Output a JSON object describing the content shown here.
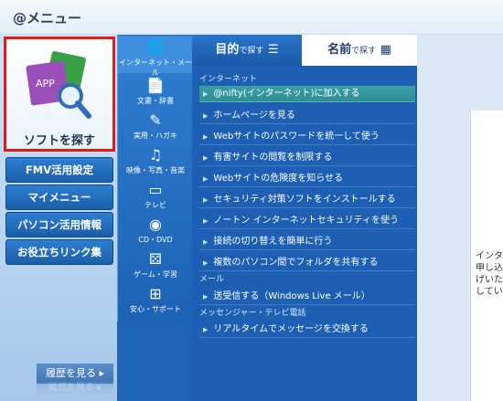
{
  "app": {
    "title": "@メニュー"
  },
  "left": {
    "find_software": "ソフトを探す",
    "app_icon_label": "APP",
    "menu": [
      {
        "label": "FMV活用設定"
      },
      {
        "label": "マイメニュー"
      },
      {
        "label": "パソコン活用情報"
      },
      {
        "label": "お役立ちリンク集"
      }
    ],
    "history": "履歴を見る ▸",
    "history_reflection": "履歴を見る ▸"
  },
  "categories": [
    {
      "label": "インターネット・メール",
      "icon": "globe-mail-icon",
      "glyph": "🌐"
    },
    {
      "label": "文書・辞書",
      "icon": "document-icon",
      "glyph": "📄"
    },
    {
      "label": "実用・ハガキ",
      "icon": "postcard-icon",
      "glyph": "✎"
    },
    {
      "label": "映像・写真・音楽",
      "icon": "media-icon",
      "glyph": "♫"
    },
    {
      "label": "テレビ",
      "icon": "tv-icon",
      "glyph": "▭"
    },
    {
      "label": "CD・DVD",
      "icon": "disc-icon",
      "glyph": "◉"
    },
    {
      "label": "ゲーム・学習",
      "icon": "dice-icon",
      "glyph": "⚄"
    },
    {
      "label": "安心・サポート",
      "icon": "windows-icon",
      "glyph": "⊞"
    }
  ],
  "tabs": {
    "purpose": "目的",
    "purpose_suffix": "で探す",
    "name": "名前",
    "name_suffix": "で探す"
  },
  "sections": [
    {
      "title": "インターネット",
      "items": [
        "@nifty(インターネット)に加入する",
        "ホームページを見る",
        "Webサイトのパスワードを統一して使う",
        "有害サイトの閲覧を制限する",
        "Webサイトの危険度を知らせる",
        "セキュリティ対策ソフトをインストールする",
        "ノートン インターネットセキュリティを使う",
        "接続の切り替えを簡単に行う",
        "複数のパソコン間でフォルダを共有する"
      ]
    },
    {
      "title": "メール",
      "items": [
        "送受信する（Windows Live メール）"
      ]
    },
    {
      "title": "メッセンジャー・テレビ電話",
      "items": [
        "リアルタイムでメッセージを交換する"
      ]
    }
  ],
  "right_text": [
    "インタ",
    "申し込",
    "げいた",
    "してい"
  ],
  "colors": {
    "accent": "#1f66b8",
    "highlight": "#2c8f95",
    "selection_border": "#e01b1b"
  }
}
